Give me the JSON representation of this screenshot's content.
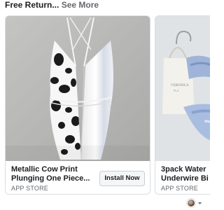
{
  "header": {
    "title": "Free Return...",
    "see_more": "See More"
  },
  "cards": [
    {
      "title_line1": "Metallic Cow Print",
      "title_line2": "Plunging One Piece...",
      "source": "APP STORE",
      "cta": "Install Now"
    },
    {
      "title_line1": "3pack Water",
      "title_line2": "Underwire Bi",
      "source": "APP STORE"
    }
  ],
  "footer": {
    "avatar_icon": "profile-avatar",
    "dropdown_icon": "caret-down-icon"
  }
}
